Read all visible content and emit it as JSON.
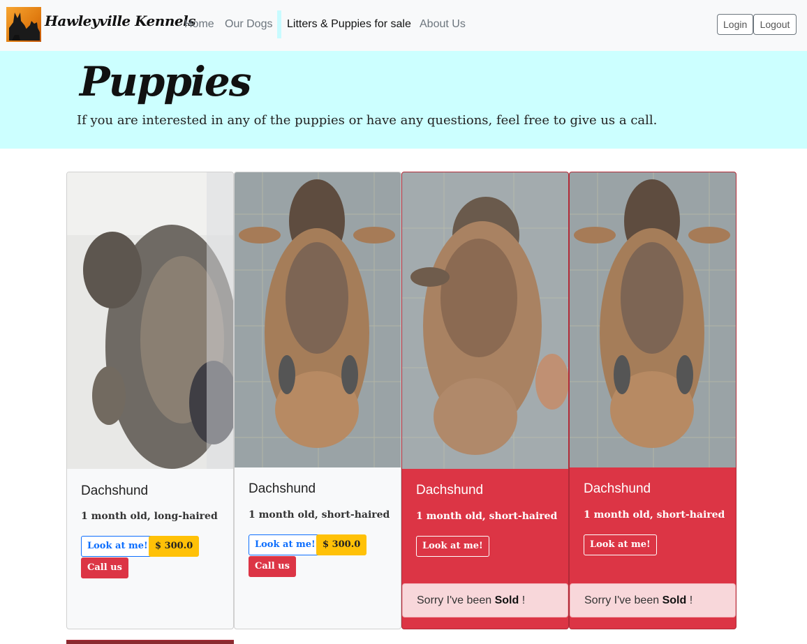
{
  "brand": "Hawleyville Kennels",
  "nav": {
    "items": [
      {
        "label": "Home"
      },
      {
        "label": "Our Dogs"
      },
      {
        "label": "Litters & Puppies for sale"
      },
      {
        "label": "About Us"
      }
    ],
    "login_label": "Login",
    "logout_label": "Logout"
  },
  "hero": {
    "title": "Puppies",
    "text": "If you are interested in any of the puppies or have any questions, feel free to give us a call."
  },
  "puppies": [
    {
      "breed": "Dachshund",
      "description": "1 month old, long-haired",
      "look_label": "Look at me!",
      "price": "$ 300.0",
      "call_label": "Call us",
      "sold": false
    },
    {
      "breed": "Dachshund",
      "description": "1 month old, short-haired",
      "look_label": "Look at me!",
      "price": "$ 300.0",
      "call_label": "Call us",
      "sold": false
    },
    {
      "breed": "Dachshund",
      "description": "1 month old, short-haired",
      "look_label": "Look at me!",
      "sold": true,
      "sold_prefix": "Sorry I've been",
      "sold_word": "Sold",
      "sold_suffix": "!"
    },
    {
      "breed": "Dachshund",
      "description": "1 month old, short-haired",
      "look_label": "Look at me!",
      "sold": true,
      "sold_prefix": "Sorry I've been",
      "sold_word": "Sold",
      "sold_suffix": "!"
    }
  ],
  "colors": {
    "navbar_bg": "#f8f9fa",
    "hero_bg": "#ccffff",
    "sold_card": "#dc3545",
    "price_badge": "#ffc107",
    "primary": "#0d6efd"
  }
}
